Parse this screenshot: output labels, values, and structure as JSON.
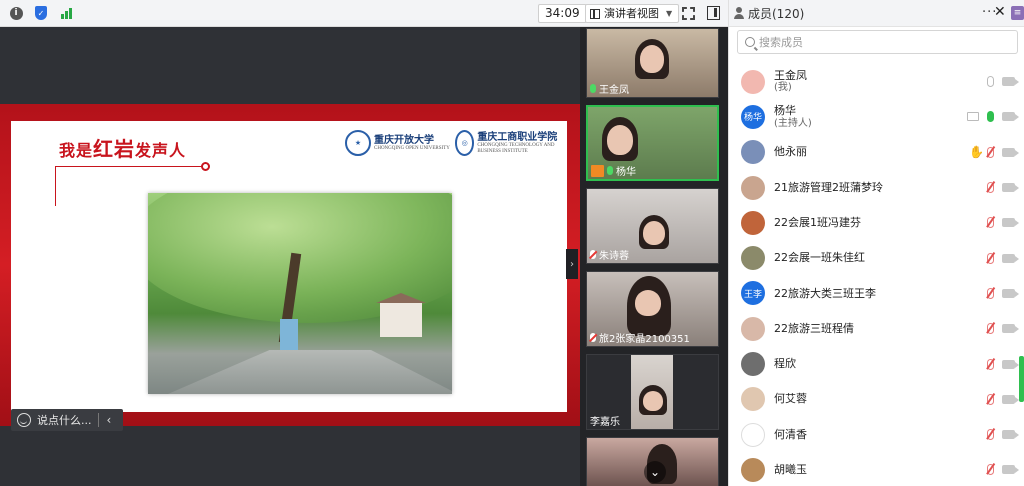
{
  "toolbar": {
    "timer": "34:09",
    "view_label": "演讲者视图",
    "icons": [
      "info-icon",
      "shield-icon",
      "signal-icon",
      "fullscreen-icon",
      "side-panel-icon"
    ]
  },
  "slide": {
    "title_prefix": "我是",
    "title_big": "红岩",
    "title_suffix": "发声人",
    "logo1": "重庆开放大学",
    "logo1_sub": "CHONGQING OPEN UNIVERSITY",
    "logo2": "重庆工商职业学院",
    "logo2_sub": "CHONGQING TECHNOLOGY AND BUSINESS INSTITUTE"
  },
  "chat": {
    "placeholder": "说点什么..."
  },
  "videos": [
    {
      "name": "王金凤",
      "mic": "on"
    },
    {
      "name": "杨华",
      "mic": "active"
    },
    {
      "name": "朱诗蓉",
      "mic": "off"
    },
    {
      "name": "旅2张家晶2100351",
      "mic": "off"
    },
    {
      "name": "李嘉乐",
      "mic": "none"
    },
    {
      "name": "",
      "mic": "none"
    }
  ],
  "members": {
    "title": "成员(120)",
    "search_placeholder": "搜索成员",
    "colors": {
      "accent": "#2a6ee0",
      "green": "#2fbf4f",
      "muted_red": "#e05050"
    },
    "list": [
      {
        "name": "王金凤",
        "sub": "(我)",
        "avatar_text": "",
        "avatar_color": "#f2b8b0",
        "status": "self"
      },
      {
        "name": "杨华",
        "sub": "(主持人)",
        "avatar_text": "杨华",
        "avatar_color": "#1e6fe0",
        "status": "host"
      },
      {
        "name": "他永丽",
        "sub": "",
        "avatar_text": "",
        "avatar_color": "#7a8fb8",
        "status": "hand"
      },
      {
        "name": "21旅游管理2班蒲梦玲",
        "sub": "",
        "avatar_text": "",
        "avatar_color": "#c9a58f",
        "status": "muted"
      },
      {
        "name": "22会展1班冯建芬",
        "sub": "",
        "avatar_text": "",
        "avatar_color": "#c0643a",
        "status": "muted"
      },
      {
        "name": "22会展一班朱佳红",
        "sub": "",
        "avatar_text": "",
        "avatar_color": "#8b8a6a",
        "status": "muted"
      },
      {
        "name": "22旅游大类三班王李",
        "sub": "",
        "avatar_text": "王李",
        "avatar_color": "#1e6fe0",
        "status": "muted"
      },
      {
        "name": "22旅游三班程倩",
        "sub": "",
        "avatar_text": "",
        "avatar_color": "#d8b8a8",
        "status": "muted"
      },
      {
        "name": "程欣",
        "sub": "",
        "avatar_text": "",
        "avatar_color": "#6e6e6e",
        "status": "muted"
      },
      {
        "name": "何艾蓉",
        "sub": "",
        "avatar_text": "",
        "avatar_color": "#e0c7b0",
        "status": "muted"
      },
      {
        "name": "何清香",
        "sub": "",
        "avatar_text": "",
        "avatar_color": "#ffffff",
        "status": "muted"
      },
      {
        "name": "胡曦玉",
        "sub": "",
        "avatar_text": "",
        "avatar_color": "#b88a5a",
        "status": "muted"
      }
    ]
  }
}
